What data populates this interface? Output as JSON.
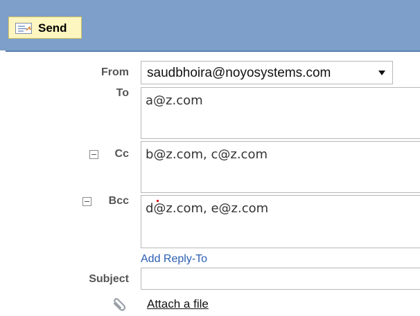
{
  "toolbar": {
    "send_label": "Send"
  },
  "from": {
    "label": "From",
    "value": "saudbhoira@noyosystems.com"
  },
  "to": {
    "label": "To",
    "value": "a@z.com"
  },
  "cc": {
    "label": "Cc",
    "value": "b@z.com, c@z.com"
  },
  "bcc": {
    "label": "Bcc",
    "value": "d@z.com, e@z.com"
  },
  "reply_to": {
    "label": "Add Reply-To"
  },
  "subject": {
    "label": "Subject",
    "value": ""
  },
  "attach": {
    "label": "Attach a file"
  },
  "icons": {
    "send": "send-envelope-icon",
    "dropdown": "chevron-down-icon",
    "collapse": "minus-box-icon",
    "attach": "paperclip-icon"
  },
  "colors": {
    "toolbar": "#7d9fc9",
    "send_button": "#fdf6c0",
    "link": "#2a5db0"
  }
}
